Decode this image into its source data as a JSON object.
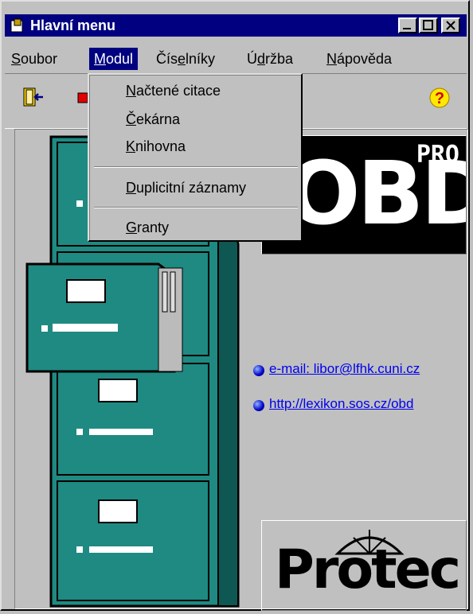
{
  "window": {
    "title": "Hlavní menu"
  },
  "menubar": {
    "items": [
      {
        "label": "Soubor",
        "accel": "S",
        "rest": "oubor"
      },
      {
        "label": "Modul",
        "accel": "M",
        "rest": "odul"
      },
      {
        "label": "Číselníky",
        "pre": "Čís",
        "accel": "e",
        "rest": "lníky"
      },
      {
        "label": "Údržba",
        "pre": "Ú",
        "accel": "d",
        "rest": "ržba"
      },
      {
        "label": "Nápověda",
        "accel": "N",
        "rest": "ápověda"
      }
    ]
  },
  "dropdown": {
    "items": [
      {
        "label": "Načtené citace",
        "accel": "N",
        "rest": "ačtené citace"
      },
      {
        "label": "Čekárna",
        "accel": "Č",
        "rest": "ekárna"
      },
      {
        "label": "Knihovna",
        "accel": "K",
        "rest": "nihovna"
      },
      {
        "label": "Duplicitní záznamy",
        "accel": "D",
        "rest": "uplicitní záznamy"
      },
      {
        "label": "Granty",
        "accel": "G",
        "rest": "ranty"
      }
    ]
  },
  "logo": {
    "text": "OBD",
    "badge": "PRO"
  },
  "company_logo": {
    "text": "Protec"
  },
  "links": {
    "email": "e-mail: libor@lfhk.cuni.cz",
    "web": "http://lexikon.sos.cz/obd"
  },
  "colors": {
    "cabinet": "#1f8a82",
    "title": "#000080",
    "link": "#0000ee"
  }
}
